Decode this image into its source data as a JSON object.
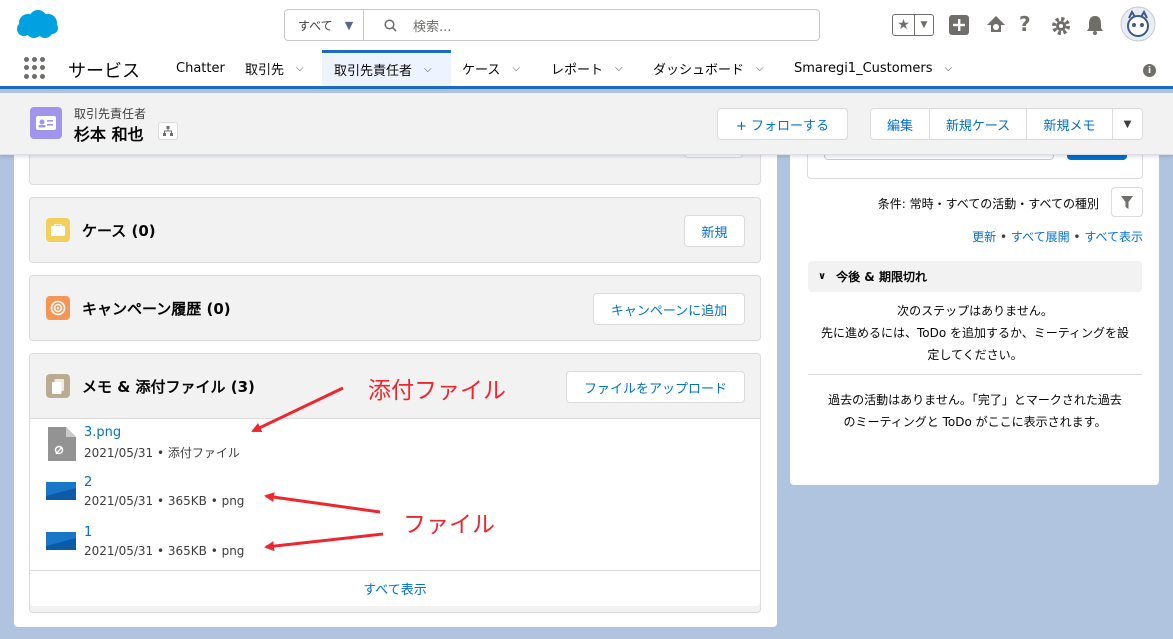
{
  "global_header": {
    "search_scope": "すべて",
    "search_placeholder": "検索..."
  },
  "nav": {
    "app_name": "サービス",
    "items": [
      {
        "label": "Chatter",
        "has_menu": false
      },
      {
        "label": "取引先",
        "has_menu": true
      },
      {
        "label": "取引先責任者",
        "has_menu": true,
        "active": true
      },
      {
        "label": "ケース",
        "has_menu": true
      },
      {
        "label": "レポート",
        "has_menu": true
      },
      {
        "label": "ダッシュボード",
        "has_menu": true
      },
      {
        "label": "Smaregi1_Customers",
        "has_menu": true
      }
    ]
  },
  "record": {
    "type_label": "取引先責任者",
    "name": "杉本 和也",
    "follow_label": "+ フォローする",
    "actions": [
      "編集",
      "新規ケース",
      "新規メモ"
    ]
  },
  "cards": {
    "cases": {
      "title": "ケース (0)",
      "button": "新規"
    },
    "campaign": {
      "title": "キャンペーン履歴 (0)",
      "button": "キャンペーンに追加"
    },
    "notes": {
      "title": "メモ & 添付ファイル (3)",
      "button": "ファイルをアップロード",
      "files": [
        {
          "name": "3.png",
          "meta": "2021/05/31 • 添付ファイル",
          "kind": "attachment"
        },
        {
          "name": "2",
          "meta": "2021/05/31 • 365KB • png",
          "kind": "file"
        },
        {
          "name": "1",
          "meta": "2021/05/31 • 365KB • png",
          "kind": "file"
        }
      ],
      "view_all": "すべて表示"
    }
  },
  "activity": {
    "filter_text": "条件: 常時・すべての活動・すべての種別",
    "link_refresh": "更新",
    "link_expand": "すべて展開",
    "link_show_all": "すべて表示",
    "upcoming_title": "今後 & 期限切れ",
    "no_steps_1": "次のステップはありません。",
    "no_steps_2": "先に進めるには、ToDo を追加するか、ミーティングを設",
    "no_steps_3": "定してください。",
    "past_1": "過去の活動はありません。「完了」とマークされた過去",
    "past_2": "のミーティングと ToDo がここに表示されます。"
  },
  "annotations": {
    "attachment_label": "添付ファイル",
    "file_label": "ファイル"
  },
  "colors": {
    "brand": "#1b6bc0",
    "link": "#0070d2",
    "annotation": "#f0262f",
    "background": "#b0c4df"
  }
}
